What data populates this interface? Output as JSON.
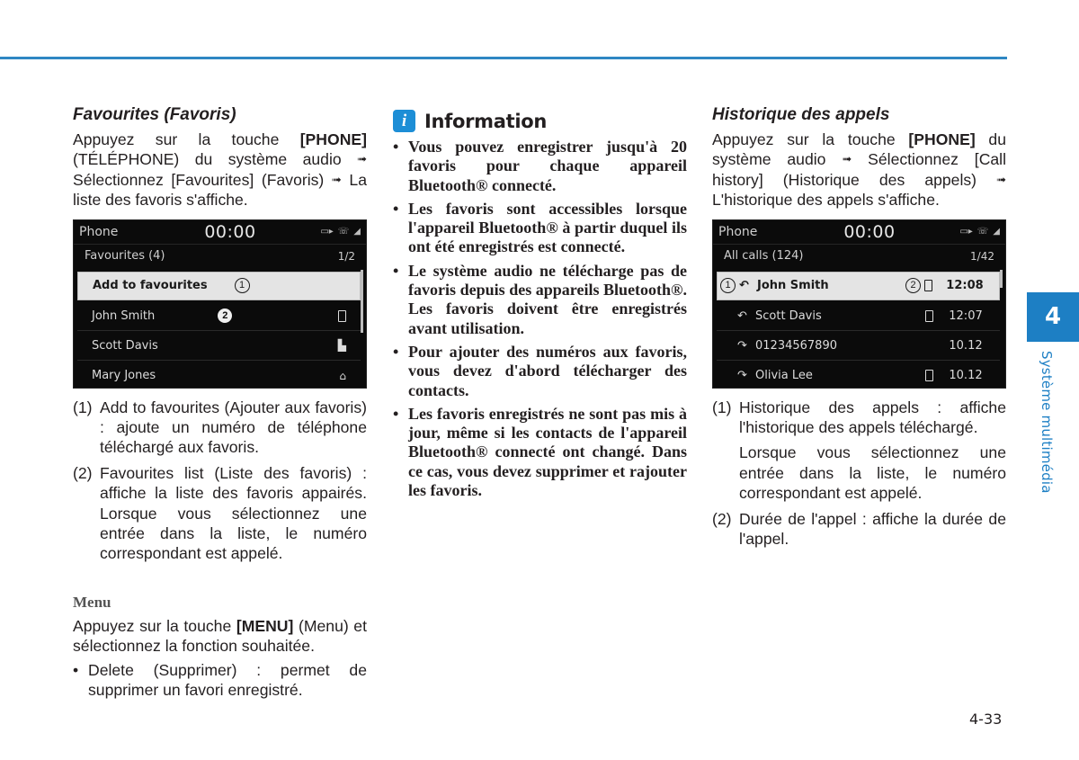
{
  "colors": {
    "accent": "#1d7fc4",
    "rule": "#2f87c3",
    "info_icon": "#1d8ed6"
  },
  "left": {
    "title": "Favourites (Favoris)",
    "intro": {
      "p1": "Appuyez sur la touche ",
      "bold1": "[PHONE]",
      "p2": " (TÉLÉPHONE) du système audio ",
      "arrow": "➟",
      "p3": " Sélectionnez [Favourites] (Favoris) ",
      "p4": " La liste des favoris s'affiche."
    },
    "screen": {
      "app": "Phone",
      "clock": "00:00",
      "status_icons": [
        "battery-icon",
        "bluetooth-phone-icon",
        "signal-icon"
      ],
      "sub_title": "Favourites (4)",
      "page": "1/2",
      "rows": [
        {
          "label": "Add to favourites",
          "callout": "1",
          "icon": ""
        },
        {
          "label": "John Smith",
          "callout": "2",
          "icon": "mobile-icon"
        },
        {
          "label": "Scott Davis",
          "callout": "",
          "icon": "office-icon"
        },
        {
          "label": "Mary Jones",
          "callout": "",
          "icon": "home-icon"
        }
      ]
    },
    "notes": [
      {
        "num": "(1)",
        "text": "Add to favourites (Ajouter aux favoris) : ajoute un numéro de téléphone téléchargé aux favoris."
      },
      {
        "num": "(2)",
        "text": "Favourites list (Liste des favoris) : affiche la liste des favoris appairés. Lorsque vous sélectionnez une entrée dans la liste, le numéro correspondant est appelé."
      }
    ],
    "menu": {
      "heading": "Menu",
      "p1": "Appuyez sur la touche ",
      "bold": "[MENU]",
      "p2": " (Menu) et sélectionnez la fonction souhaitée.",
      "bullet": "Delete (Supprimer) : permet de supprimer un favori enregistré."
    }
  },
  "middle": {
    "icon_glyph": "i",
    "title": "Information",
    "bullets": [
      "Vous pouvez enregistrer jusqu'à 20 favoris pour chaque appareil Bluetooth® connecté.",
      "Les favoris sont accessibles lorsque l'appareil Bluetooth® à partir duquel ils ont été enregistrés est connecté.",
      "Le système audio ne télécharge pas de favoris depuis des appareils Bluetooth®. Les favoris doivent être enregistrés avant utilisation.",
      "Pour ajouter des numéros aux favoris, vous devez d'abord télécharger des contacts.",
      "Les favoris enregistrés ne sont pas mis à jour, même si les contacts de l'appareil Bluetooth® connecté ont changé. Dans ce cas, vous devez supprimer et rajouter les favoris."
    ]
  },
  "right": {
    "title": "Historique des appels",
    "intro": {
      "p1": "Appuyez sur la touche ",
      "bold1": "[PHONE]",
      "p2": " du système audio ",
      "arrow": "➟",
      "p3": " Sélectionnez [Call history] (Historique des appels) ",
      "p4": " L'historique des appels s'affiche."
    },
    "screen": {
      "app": "Phone",
      "clock": "00:00",
      "status_icons": [
        "battery-icon",
        "bluetooth-phone-icon",
        "signal-icon"
      ],
      "sub_title": "All calls (124)",
      "page": "1/42",
      "rows": [
        {
          "label": "John Smith",
          "call_type": "outgoing-call-icon",
          "device": "mobile-icon",
          "time": "12:08",
          "callout_left": "1",
          "callout_right": "2"
        },
        {
          "label": "Scott Davis",
          "call_type": "outgoing-call-icon",
          "device": "mobile-icon",
          "time": "12:07"
        },
        {
          "label": "01234567890",
          "call_type": "missed-call-icon",
          "device": "",
          "time": "10.12"
        },
        {
          "label": "Olivia Lee",
          "call_type": "missed-call-icon",
          "device": "mobile-icon",
          "time": "10.12"
        }
      ]
    },
    "notes": [
      {
        "num": "(1)",
        "text1": "Historique des appels : affiche l'historique des appels téléchargé.",
        "text2": "Lorsque vous sélectionnez une entrée dans la liste, le numéro correspondant est appelé."
      },
      {
        "num": "(2)",
        "text1": "Durée de l'appel : affiche la durée de l'appel."
      }
    ]
  },
  "side_tab": {
    "chapter": "4",
    "label": "Système multimédia"
  },
  "page_number": "4-33"
}
